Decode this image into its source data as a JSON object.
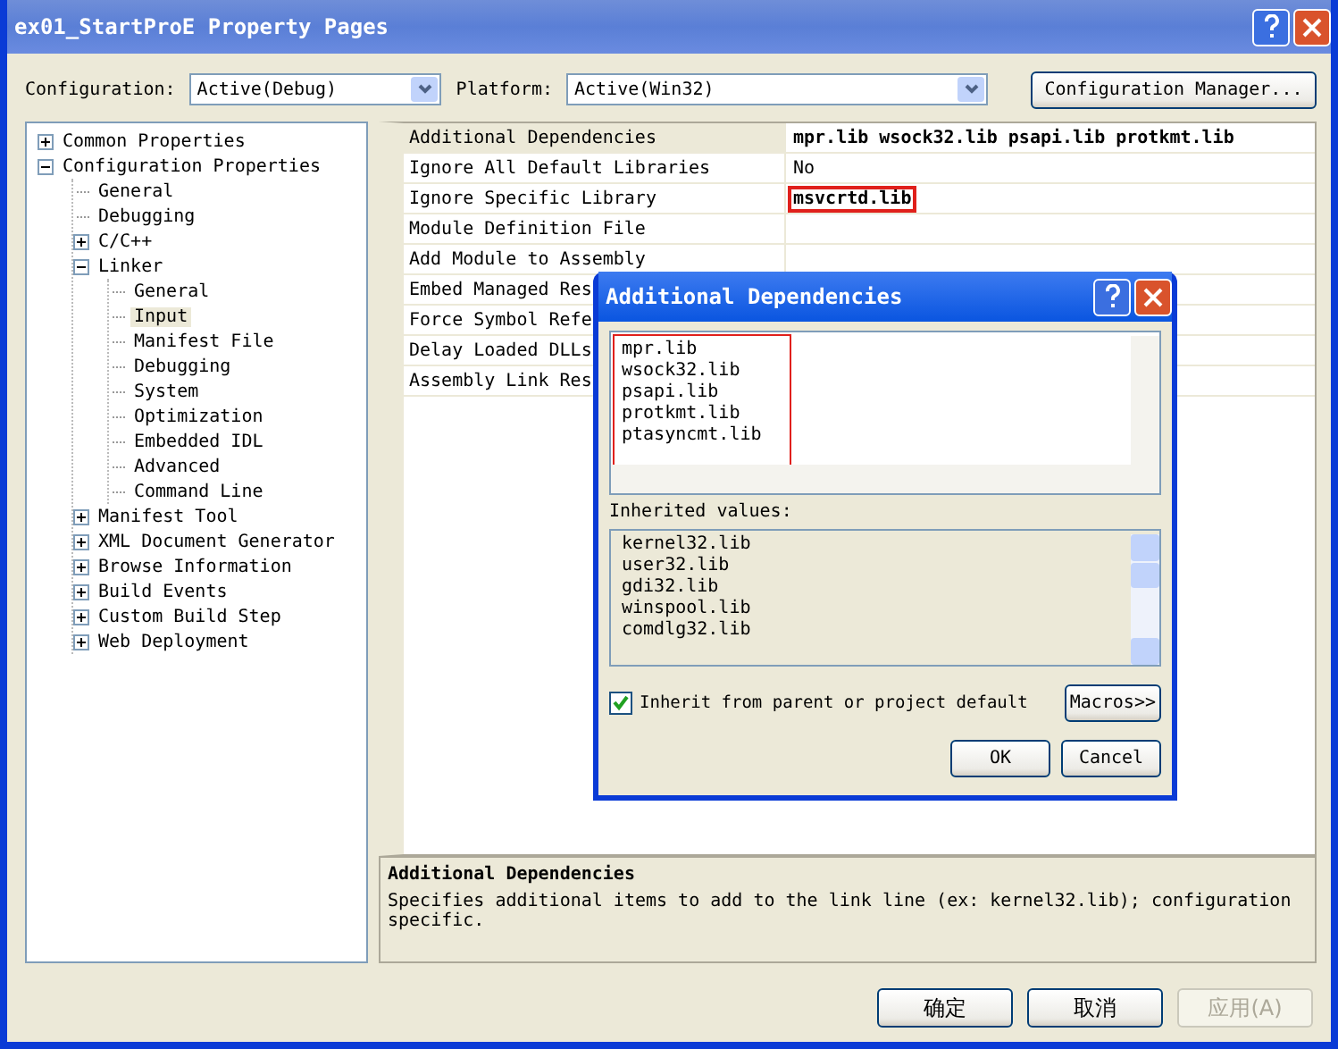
{
  "window": {
    "title": "ex01_StartProE Property Pages"
  },
  "toolbar": {
    "configuration_label": "Configuration:",
    "configuration": "Active(Debug)",
    "platform_label": "Platform:",
    "platform": "Active(Win32)",
    "manager_button": "Configuration Manager..."
  },
  "tree": [
    {
      "label": "Common Properties",
      "expanded": false,
      "selected": false
    },
    {
      "label": "Configuration Properties",
      "expanded": true,
      "selected": false,
      "children": [
        {
          "label": "General",
          "selected": false
        },
        {
          "label": "Debugging",
          "selected": false
        },
        {
          "label": "C/C++",
          "expanded": false,
          "selected": false
        },
        {
          "label": "Linker",
          "expanded": true,
          "selected": false,
          "children": [
            {
              "label": "General",
              "selected": false
            },
            {
              "label": "Input",
              "selected": true
            },
            {
              "label": "Manifest File",
              "selected": false
            },
            {
              "label": "Debugging",
              "selected": false
            },
            {
              "label": "System",
              "selected": false
            },
            {
              "label": "Optimization",
              "selected": false
            },
            {
              "label": "Embedded IDL",
              "selected": false
            },
            {
              "label": "Advanced",
              "selected": false
            },
            {
              "label": "Command Line",
              "selected": false
            }
          ]
        },
        {
          "label": "Manifest Tool",
          "expanded": false,
          "selected": false
        },
        {
          "label": "XML Document Generator",
          "expanded": false,
          "selected": false
        },
        {
          "label": "Browse Information",
          "expanded": false,
          "selected": false
        },
        {
          "label": "Build Events",
          "expanded": false,
          "selected": false
        },
        {
          "label": "Custom Build Step",
          "expanded": false,
          "selected": false
        },
        {
          "label": "Web Deployment",
          "expanded": false,
          "selected": false
        }
      ]
    }
  ],
  "properties": [
    {
      "name": "Additional Dependencies",
      "value": "mpr.lib wsock32.lib psapi.lib protkmt.lib",
      "modified": true,
      "highlighted": false,
      "selected": true
    },
    {
      "name": "Ignore All Default Libraries",
      "value": "No",
      "modified": false,
      "highlighted": false,
      "selected": false
    },
    {
      "name": "Ignore Specific Library",
      "value": "msvcrtd.lib",
      "modified": true,
      "highlighted": true,
      "selected": false
    },
    {
      "name": "Module Definition File",
      "selected": false
    },
    {
      "name": "Add Module to Assembly",
      "selected": false
    },
    {
      "name": "Embed Managed Res",
      "selected": false
    },
    {
      "name": "Force Symbol Refe",
      "selected": false
    },
    {
      "name": "Delay Loaded DLLs",
      "selected": false
    },
    {
      "name": "Assembly Link Res",
      "selected": false
    }
  ],
  "description": {
    "title": "Additional Dependencies",
    "text": "Specifies additional items to add to the link line (ex: kernel32.lib); configuration specific."
  },
  "buttons": [
    {
      "label": "确定",
      "disabled": false
    },
    {
      "label": "取消",
      "disabled": false
    },
    {
      "label": "应用(A)",
      "disabled": true
    }
  ],
  "dialog": {
    "title": "Additional Dependencies",
    "values": [
      "mpr.lib",
      "wsock32.lib",
      "psapi.lib",
      "protkmt.lib",
      "ptasyncmt.lib"
    ],
    "values_highlighted": true,
    "inherited_label": "Inherited values:",
    "inherited": [
      "kernel32.lib",
      "user32.lib",
      "gdi32.lib",
      "winspool.lib",
      "comdlg32.lib"
    ],
    "inherit_label": "Inherit from parent or project default",
    "inherit_checked": true,
    "macros_button": "Macros>>",
    "ok_button": "OK",
    "cancel_button": "Cancel"
  }
}
